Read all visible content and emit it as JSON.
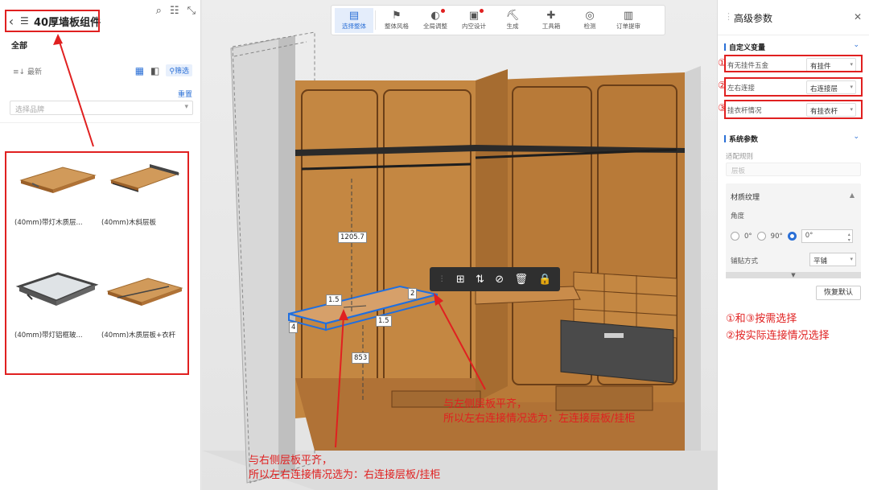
{
  "left_panel": {
    "title": "40厚墙板组件",
    "all_label": "全部",
    "sort_label": "最新",
    "filter_label": "筛选",
    "reset_label": "重置",
    "brand_placeholder": "选择品牌",
    "products": [
      {
        "label": "(40mm)带灯木质层..."
      },
      {
        "label": "(40mm)木斜层板"
      },
      {
        "label": "(40mm)带灯铝框玻..."
      },
      {
        "label": "(40mm)木质层板+衣杆"
      }
    ]
  },
  "toolbar": {
    "items": [
      {
        "label": "选择整体",
        "icon": "select-icon"
      },
      {
        "label": "整体风格",
        "icon": "style-icon"
      },
      {
        "label": "全局调整",
        "icon": "global-icon"
      },
      {
        "label": "内空设计",
        "icon": "inner-design-icon"
      },
      {
        "label": "生成",
        "icon": "generate-icon"
      },
      {
        "label": "工具箱",
        "icon": "toolbox-icon"
      },
      {
        "label": "检测",
        "icon": "detect-icon"
      },
      {
        "label": "订单提审",
        "icon": "order-icon"
      }
    ]
  },
  "viewport": {
    "dims": {
      "d1": "1205.7",
      "d2": "1.5",
      "d3": "2",
      "d4": "4",
      "d5": "1.5",
      "d6": "853"
    },
    "annotations": {
      "left_line1": "与右侧层板平齐，",
      "left_line2": "所以左右连接情况选为：右连接层板/挂柜",
      "right_line1": "与左侧层板平齐，",
      "right_line2": "所以左右连接情况选为：左连接层板/挂柜"
    }
  },
  "right_panel": {
    "title": "高级参数",
    "custom_section": "自定义变量",
    "params": [
      {
        "num": "①",
        "label": "有无挂件五金",
        "value": "有挂件"
      },
      {
        "num": "②",
        "label": "左右连接",
        "value": "右连接层"
      },
      {
        "num": "③",
        "label": "挂衣杆情况",
        "value": "有挂衣杆"
      }
    ],
    "system_section": "系统参数",
    "rule_label": "适配规则",
    "rule_value": "层板",
    "material_title": "材质纹理",
    "angle_label": "角度",
    "angle_options": [
      "0°",
      "90°"
    ],
    "angle_value": "0°",
    "paste_label": "铺贴方式",
    "paste_value": "平铺",
    "restore_label": "恢复默认",
    "notes": [
      "①和③按需选择",
      "②按实际连接情况选择"
    ]
  },
  "colors": {
    "accent": "#2a6fd6",
    "annotation_red": "#e02020",
    "wood": "#c8843f"
  }
}
